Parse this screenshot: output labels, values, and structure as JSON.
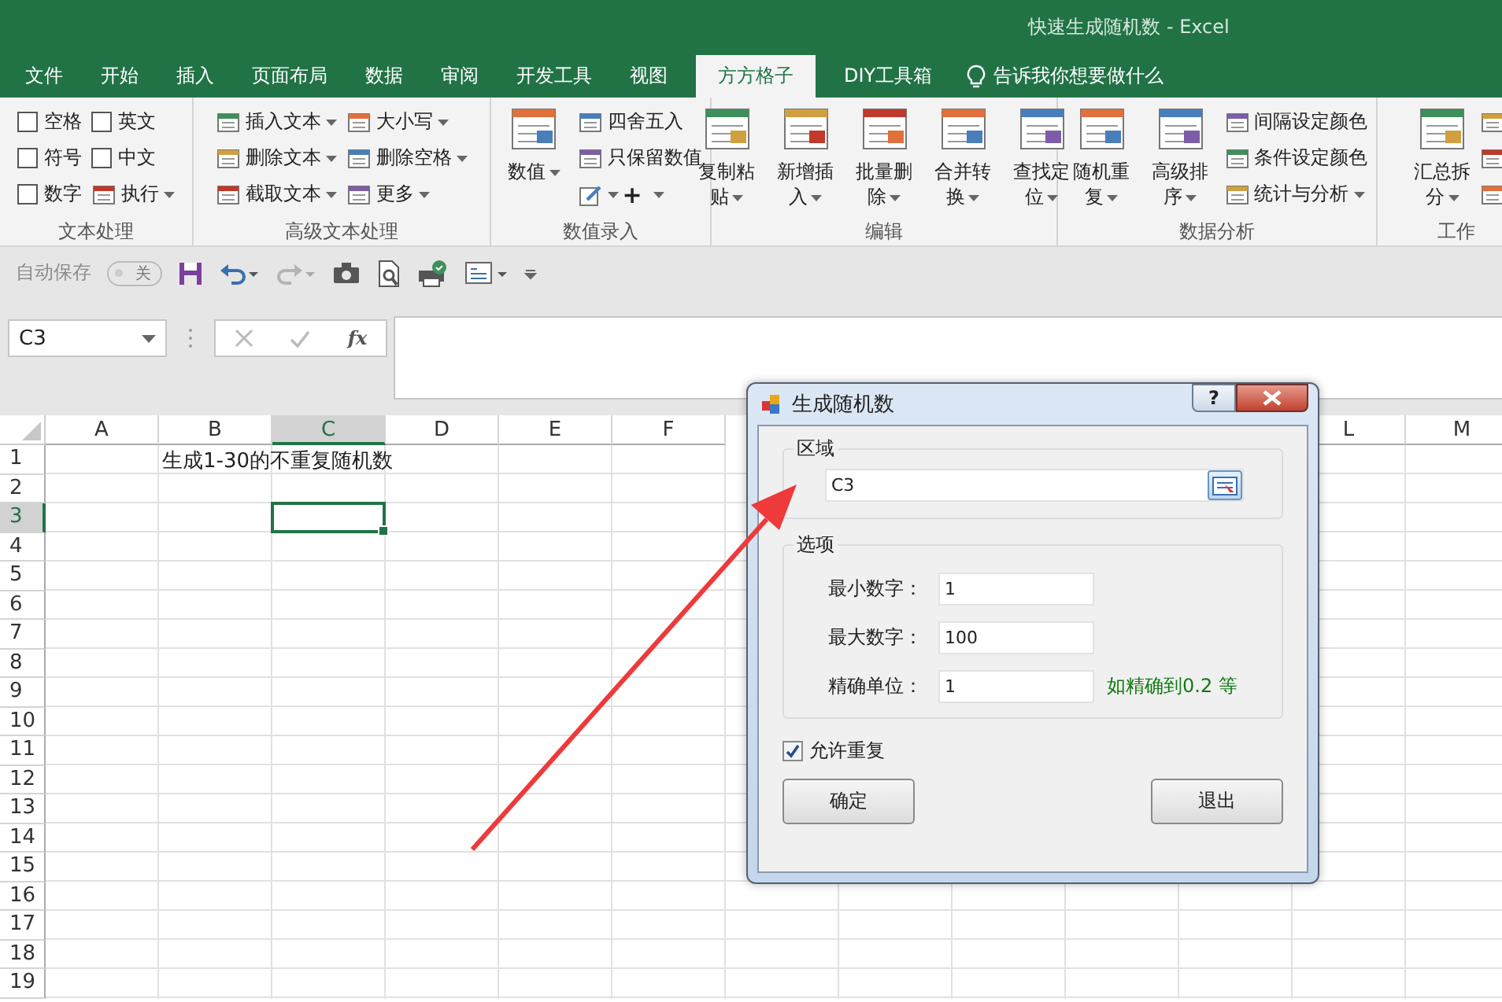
{
  "window": {
    "title": "快速生成随机数  -  Excel"
  },
  "tabs": [
    {
      "label": "文件",
      "selected": false
    },
    {
      "label": "开始",
      "selected": false
    },
    {
      "label": "插入",
      "selected": false
    },
    {
      "label": "页面布局",
      "selected": false
    },
    {
      "label": "数据",
      "selected": false
    },
    {
      "label": "审阅",
      "selected": false
    },
    {
      "label": "开发工具",
      "selected": false
    },
    {
      "label": "视图",
      "selected": false
    },
    {
      "label": "方方格子",
      "selected": true
    },
    {
      "label": "DIY工具箱",
      "selected": false
    }
  ],
  "tell_me": {
    "placeholder": "告诉我你想要做什么"
  },
  "ribbon": {
    "groups": [
      {
        "label": "文本处理",
        "items": [
          {
            "kind": "checkbox",
            "label": "空格",
            "checked": false
          },
          {
            "kind": "checkbox",
            "label": "符号",
            "checked": false
          },
          {
            "kind": "checkbox",
            "label": "数字",
            "checked": false
          },
          {
            "kind": "checkbox",
            "label": "英文",
            "checked": false
          },
          {
            "kind": "checkbox",
            "label": "中文",
            "checked": false
          },
          {
            "kind": "small",
            "label": "执行",
            "menu": true
          }
        ]
      },
      {
        "label": "高级文本处理",
        "items": [
          {
            "kind": "small",
            "label": "插入文本",
            "menu": true
          },
          {
            "kind": "small",
            "label": "删除文本",
            "menu": true
          },
          {
            "kind": "small",
            "label": "截取文本",
            "menu": true
          },
          {
            "kind": "small",
            "label": "大小写",
            "menu": true
          },
          {
            "kind": "small",
            "label": "删除空格",
            "menu": true
          },
          {
            "kind": "small",
            "label": "更多",
            "menu": true
          }
        ]
      },
      {
        "label": "数值录入",
        "items": [
          {
            "kind": "large",
            "label": "数值",
            "menu": true
          },
          {
            "kind": "small",
            "label": "四舍五入",
            "menu": false
          },
          {
            "kind": "small",
            "label": "只保留数值",
            "menu": false
          },
          {
            "kind": "icon",
            "menu": true
          },
          {
            "kind": "glyph",
            "label": "+",
            "menu": true
          }
        ]
      },
      {
        "label": "编辑",
        "items": [
          {
            "kind": "large",
            "label": "复制粘贴",
            "menu": true
          },
          {
            "kind": "large",
            "label": "新增插入",
            "menu": true
          },
          {
            "kind": "large",
            "label": "批量删除",
            "menu": true
          },
          {
            "kind": "large",
            "label": "合并转换",
            "menu": true
          },
          {
            "kind": "large",
            "label": "查找定位",
            "menu": true
          }
        ]
      },
      {
        "label": "数据分析",
        "items": [
          {
            "kind": "large",
            "label": "随机重复",
            "menu": true
          },
          {
            "kind": "large",
            "label": "高级排序",
            "menu": true
          },
          {
            "kind": "small",
            "label": "间隔设定颜色",
            "menu": false
          },
          {
            "kind": "small",
            "label": "条件设定颜色",
            "menu": false
          },
          {
            "kind": "small",
            "label": "统计与分析",
            "menu": true
          }
        ]
      },
      {
        "label": "工作",
        "items": [
          {
            "kind": "large",
            "label": "汇总拆分",
            "menu": true
          },
          {
            "kind": "small",
            "menu": false
          },
          {
            "kind": "small",
            "menu": false
          },
          {
            "kind": "small",
            "menu": false
          }
        ]
      }
    ]
  },
  "quick_access": {
    "autosave_label": "自动保存",
    "autosave_toggle": "关",
    "autosave_on": false,
    "redo_disabled": true
  },
  "formula_bar": {
    "name_box": "C3",
    "fx_label": "fx"
  },
  "sheet": {
    "columns_left": [
      {
        "label": "A",
        "selected": false
      },
      {
        "label": "B",
        "selected": false
      },
      {
        "label": "C",
        "selected": true
      },
      {
        "label": "D",
        "selected": false
      },
      {
        "label": "E",
        "selected": false
      },
      {
        "label": "F",
        "selected": false
      }
    ],
    "columns_right": [
      {
        "label": "L",
        "selected": false
      },
      {
        "label": "M",
        "selected": false
      }
    ],
    "rows": [
      {
        "label": "1",
        "selected": false,
        "text": "生成1-30的不重复随机数"
      },
      {
        "label": "2",
        "selected": false
      },
      {
        "label": "3",
        "selected": true
      },
      {
        "label": "4",
        "selected": false
      },
      {
        "label": "5",
        "selected": false
      },
      {
        "label": "6",
        "selected": false
      },
      {
        "label": "7",
        "selected": false
      },
      {
        "label": "8",
        "selected": false
      },
      {
        "label": "9",
        "selected": false
      },
      {
        "label": "10",
        "selected": false
      },
      {
        "label": "11",
        "selected": false
      },
      {
        "label": "12",
        "selected": false
      },
      {
        "label": "13",
        "selected": false
      },
      {
        "label": "14",
        "selected": false
      },
      {
        "label": "15",
        "selected": false
      },
      {
        "label": "16",
        "selected": false
      },
      {
        "label": "17",
        "selected": false
      },
      {
        "label": "18",
        "selected": false
      },
      {
        "label": "19",
        "selected": false
      }
    ]
  },
  "dialog": {
    "title": "生成随机数",
    "help": "?",
    "range_group": "区域",
    "range_value": "C3",
    "options_group": "选项",
    "fields": [
      {
        "label": "最小数字：",
        "value": "1"
      },
      {
        "label": "最大数字：",
        "value": "100"
      },
      {
        "label": "精确单位：",
        "value": "1",
        "hint": "如精确到0.2 等"
      }
    ],
    "allow_repeat": {
      "label": "允许重复",
      "checked": true
    },
    "buttons": [
      "确定",
      "退出"
    ]
  }
}
